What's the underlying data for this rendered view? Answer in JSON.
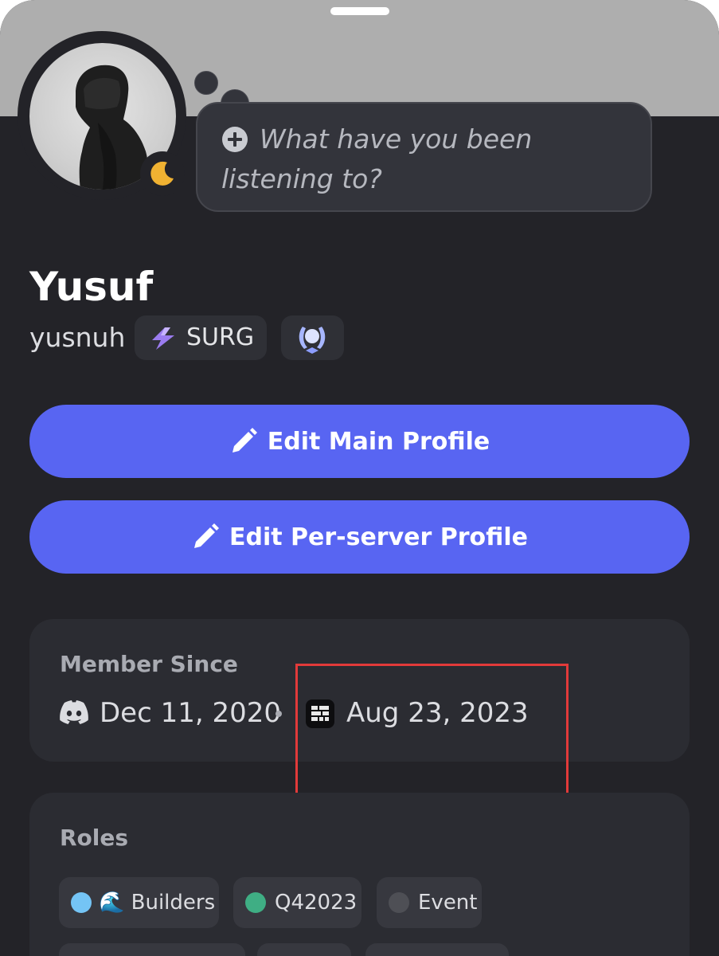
{
  "thought_bubble": {
    "placeholder": "What have you been listening to?",
    "add_icon": "plus-circle-icon"
  },
  "profile": {
    "display_name": "Yusuf",
    "username": "yusnuh",
    "status": "idle",
    "status_icon": "moon-icon",
    "avatar_icon": "hooded-figure-avatar",
    "tag": {
      "label": "SURG",
      "icon": "lightning-bolt-icon"
    },
    "badge_icon": "laurel-wreath-badge-icon"
  },
  "buttons": {
    "edit_main": "Edit Main Profile",
    "edit_server": "Edit Per-server Profile",
    "edit_icon": "pencil-icon"
  },
  "member_since": {
    "title": "Member Since",
    "discord_date": "Dec 11, 2020",
    "server_date": "Aug 23, 2023",
    "discord_icon": "discord-icon",
    "server_icon": "surgence-server-icon"
  },
  "roles": {
    "title": "Roles",
    "items": [
      {
        "label": "🌊 Builders",
        "color": "#74c4f5"
      },
      {
        "label": "Q42023",
        "color": "#3fae84"
      },
      {
        "label": "Event",
        "color": "#4e4f55"
      }
    ]
  },
  "colors": {
    "accent": "#5865f2",
    "background": "#232328",
    "card": "#2b2c32",
    "banner": "#aeaeae",
    "highlight": "#e23a3a",
    "idle": "#f0b232"
  }
}
